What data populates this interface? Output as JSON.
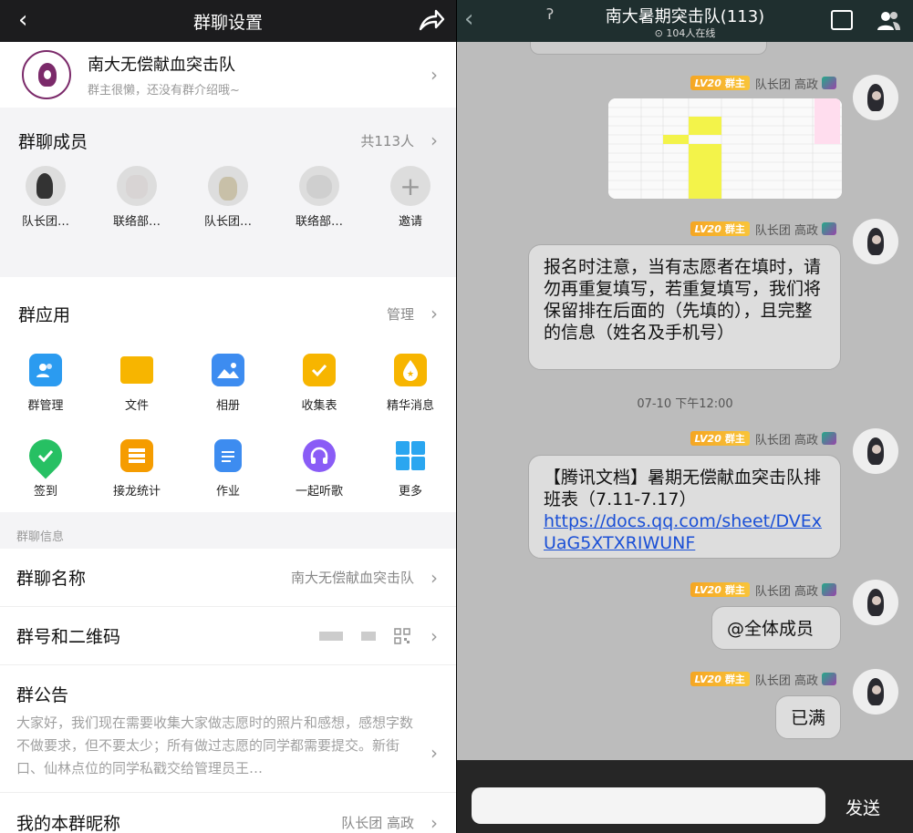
{
  "left": {
    "topbar": {
      "back": "‹",
      "title": "群聊设置"
    },
    "group": {
      "name": "南大无偿献血突击队",
      "desc": "群主很懒，还没有群介绍哦~"
    },
    "members": {
      "title": "群聊成员",
      "count": "共113人",
      "items": [
        {
          "label": "队长团…"
        },
        {
          "label": "联络部…"
        },
        {
          "label": "队长团…"
        },
        {
          "label": "联络部…"
        },
        {
          "label": "邀请"
        }
      ]
    },
    "apps": {
      "title": "群应用",
      "manage": "管理",
      "items": [
        {
          "label": "群管理",
          "color": "#2b9bf0"
        },
        {
          "label": "文件",
          "color": "#f7b500"
        },
        {
          "label": "相册",
          "color": "#3d8cf0"
        },
        {
          "label": "收集表",
          "color": "#f7b500"
        },
        {
          "label": "精华消息",
          "color": "#f7b500"
        },
        {
          "label": "签到",
          "color": "#27c063"
        },
        {
          "label": "接龙统计",
          "color": "#f59c00"
        },
        {
          "label": "作业",
          "color": "#3d8cf0"
        },
        {
          "label": "一起听歌",
          "color": "#8a5cf6"
        },
        {
          "label": "更多",
          "color": "#2aa6f0"
        }
      ]
    },
    "info": {
      "caption": "群聊信息",
      "name_label": "群聊名称",
      "name_value": "南大无偿献血突击队",
      "qr_label": "群号和二维码",
      "notice_label": "群公告",
      "notice_body": "大家好，我们现在需要收集大家做志愿时的照片和感想，感想字数不做要求，但不要太少；所有做过志愿的同学都需要提交。新街口、仙林点位的同学私戳交给管理员王…",
      "nick_label": "我的本群昵称",
      "nick_value": "队长团 高政"
    }
  },
  "right": {
    "topbar": {
      "back": "‹",
      "ear": "ʔ",
      "title": "南大暑期突击队(113)",
      "online": "⊙ 104人在线"
    },
    "sender": {
      "level": "LV20",
      "role": "群主",
      "name": "队长团 高政"
    },
    "messages": [
      {
        "type": "image"
      },
      {
        "type": "text",
        "text": "报名时注意，当有志愿者在填时，请勿再重复填写，若重复填写，我们将保留排在后面的（先填的），且完整的信息（姓名及手机号）"
      },
      {
        "type": "time",
        "text": "07-10 下午12:00"
      },
      {
        "type": "text",
        "text": "【腾讯文档】暑期无偿献血突击队排班表（7.11-7.17）",
        "link": "https://docs.qq.com/sheet/DVExUaG5XTXRIWUNF"
      },
      {
        "type": "text",
        "text": "@全体成员"
      },
      {
        "type": "text",
        "text": "已满"
      }
    ],
    "composer": {
      "send": "发送"
    }
  }
}
